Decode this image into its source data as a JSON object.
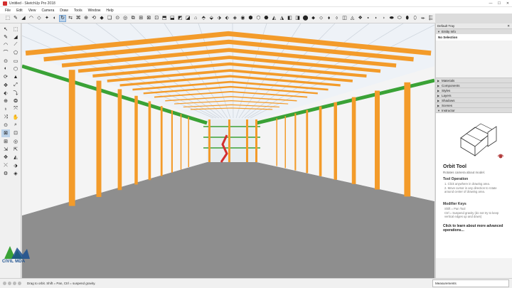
{
  "window": {
    "title": "Untitled - SketchUp Pro 2018",
    "controls": [
      "—",
      "☐",
      "✕"
    ]
  },
  "menu": [
    "File",
    "Edit",
    "View",
    "Camera",
    "Draw",
    "Tools",
    "Window",
    "Help"
  ],
  "toolbar": {
    "icons": [
      "⬚",
      "✎",
      "◢",
      "◠",
      "◇",
      "✦",
      "◐",
      "↻",
      "⇆",
      "⌘",
      "⊕",
      "⟲",
      "◆",
      "❏",
      "⊙",
      "◎",
      "⧉",
      "⊞",
      "⊠",
      "⊡",
      "⬒",
      "⬓",
      "◩",
      "◪",
      "⌂",
      "⬘",
      "⬙",
      "⬗",
      "⬖",
      "◈",
      "◉",
      "⬢",
      "⬡",
      "⬣",
      "◭",
      "◮",
      "◧",
      "◨",
      "⬤",
      "⬥",
      "⬦",
      "⬧",
      "⬨",
      "◫",
      "◬",
      "❖",
      "⬩",
      "⬪",
      "⬫",
      "⬬",
      "⬭",
      "⬮",
      "⬯",
      "⬰",
      "⬱"
    ],
    "active_index": 7
  },
  "left_tools": {
    "icons": [
      "↖",
      "⬚",
      "✎",
      "◢",
      "◠",
      "⟋",
      "⌒",
      "⬠",
      "⊙",
      "▭",
      "◐",
      "⬡",
      "⟳",
      "▲",
      "✥",
      "⤢",
      "⬖",
      "⤵",
      "⊕",
      "❂",
      "♁",
      "⤧",
      "⤨",
      "✋",
      "⊙",
      "⌕",
      "⊠",
      "⊡",
      "⊞",
      "◎",
      "⇲",
      "⇱",
      "✥",
      "◭",
      "⤬",
      "⬗",
      "⚙",
      "◈"
    ],
    "active_index": 26
  },
  "tray": {
    "title": "Default Tray",
    "close": "✕",
    "entity_info": "Entity Info",
    "selection": "No Selection",
    "panels": [
      "Materials",
      "Components",
      "Styles",
      "Layers",
      "Shadows",
      "Scenes"
    ],
    "instructor": {
      "header": "Instructor",
      "tool_name": "Orbit Tool",
      "subtitle": "Rotates camera about model.",
      "operation_heading": "Tool Operation",
      "steps": [
        "1.  Click anywhere in drawing area.",
        "2.  Move cursor in any direction to rotate around center of drawing area."
      ],
      "modifier_heading": "Modifier Keys",
      "modifiers": [
        "Shift = Pan Tool",
        "Ctrl = Suspend gravity (do not try to keep vertical edges up and down)"
      ],
      "learn_more": "Click to learn about more advanced operations..."
    }
  },
  "status": {
    "hint": "Drag to orbit. Shift = Pan, Ctrl = suspend gravity.",
    "measurements_label": "Measurements"
  },
  "logo": {
    "text": "CIVIL MDA"
  },
  "colors": {
    "steel_orange": "#f39b2a",
    "bracing_green": "#3aa236",
    "floor_gray": "#8e8e8e",
    "roof_panel": "#eef2f7",
    "accent_blue": "#bcd3ea"
  }
}
